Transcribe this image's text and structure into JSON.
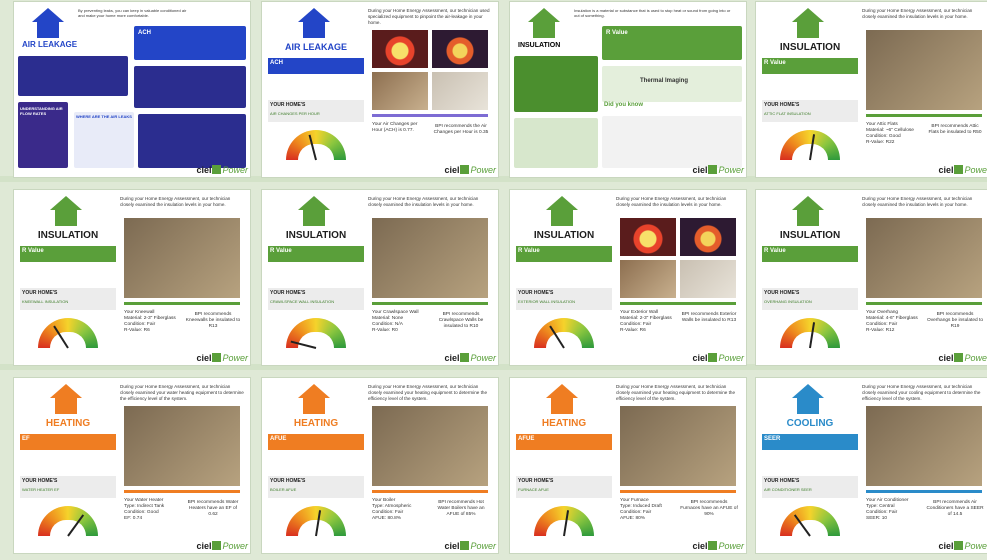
{
  "brand": {
    "logo_text": "ciel",
    "logo_power": "Power"
  },
  "pages": [
    {
      "id": "p1",
      "layout": "infographic",
      "category": "AIR LEAKAGE",
      "theme": "blue",
      "intro": "By preventing leaks, you can keep in valuable conditioned air and make your home more comfortable.",
      "tag": "ACH",
      "sub1": "UNDERSTANDING AIR FLOW RATES",
      "sub2": "WHERE ARE THE AIR LEAKS"
    },
    {
      "id": "p2",
      "layout": "quad",
      "category": "AIR LEAKAGE",
      "theme": "blue",
      "tag": "ACH",
      "intro": "During your Home Energy Assessment, our technician used specialized equipment to pinpoint the air-leakage in your home.",
      "yh_title": "YOUR HOME'S",
      "yh_sub": "AIR CHANGES PER HOUR",
      "stat_left": "Your Air Changes per Hour (ACH) is 0.77.",
      "stat_right": "BPI recommends the Air Changes per Hour is 0.35",
      "needle": 0.42
    },
    {
      "id": "p3",
      "layout": "infographic",
      "category": "INSULATION",
      "theme": "green",
      "intro": "Insulation is a material or substance that is used to stop heat or sound from going into or out of something.",
      "tag": "R Value",
      "sub1": "Thermal Imaging",
      "sub2": "Did you know"
    },
    {
      "id": "p4",
      "layout": "photo",
      "category": "INSULATION",
      "theme": "green",
      "tag": "R Value",
      "intro": "During your Home Energy Assessment, our technician closely examined the insulation levels in your home.",
      "yh_title": "YOUR HOME'S",
      "yh_sub": "ATTIC FLAT INSULATION",
      "stat_left": "Your Attic Flats\nMaterial: ~6\" Cellulose\nCondition: Good\nR-Value: R22",
      "stat_right": "BPI recommends Attic Flats be insulated to R50",
      "needle": 0.55
    },
    {
      "id": "p5",
      "layout": "photo",
      "category": "INSULATION",
      "theme": "green",
      "tag": "R Value",
      "intro": "During your Home Energy Assessment, our technician closely examined the insulation levels in your home.",
      "yh_title": "YOUR HOME'S",
      "yh_sub": "KNEEWALL INSULATION",
      "stat_left": "Your Kneewall\nMaterial: 2-3\" Fiberglass\nCondition: Fair\nR-Value: R6",
      "stat_right": "BPI recommends Kneewalls be insulated to R13",
      "needle": 0.32
    },
    {
      "id": "p6",
      "layout": "photo",
      "category": "INSULATION",
      "theme": "green",
      "tag": "R Value",
      "intro": "During your Home Energy Assessment, our technician closely examined the insulation levels in your home.",
      "yh_title": "YOUR HOME'S",
      "yh_sub": "CRAWLSPACE WALL INSULATION",
      "stat_left": "Your Crawlspace Wall\nMaterial: None\nCondition: N/A\nR-Value: R0",
      "stat_right": "BPI recommends Crawlspace Walls be insulated to R10",
      "needle": 0.08
    },
    {
      "id": "p7",
      "layout": "quad",
      "category": "INSULATION",
      "theme": "green",
      "tag": "R Value",
      "intro": "During your Home Energy Assessment, our technician closely examined the insulation levels in your home.",
      "yh_title": "YOUR HOME'S",
      "yh_sub": "EXTERIOR WALL INSULATION",
      "stat_left": "Your Exterior Wall\nMaterial: 2-3\" Fiberglass\nCondition: Fair\nR-Value: R6",
      "stat_right": "BPI recommends Exterior Walls be insulated to R13",
      "needle": 0.32
    },
    {
      "id": "p8",
      "layout": "photo",
      "category": "INSULATION",
      "theme": "green",
      "tag": "R Value",
      "intro": "During your Home Energy Assessment, our technician closely examined the insulation levels in your home.",
      "yh_title": "YOUR HOME'S",
      "yh_sub": "OVERHANG INSULATION",
      "stat_left": "Your Overhang\nMaterial: 4-6\" Fiberglass\nCondition: Fair\nR-Value: R12",
      "stat_right": "BPI recommends Overhangs be insulated to R19",
      "needle": 0.55
    },
    {
      "id": "p9",
      "layout": "photo",
      "category": "HEATING",
      "theme": "orange",
      "tag": "EF",
      "intro": "During your Home Energy Assessment, our technician closely examined your water heating equipment to determine the efficiency level of the system.",
      "yh_title": "YOUR HOME'S",
      "yh_sub": "WATER HEATER EF",
      "stat_left": "Your Water Heater\nType: Indirect Tank\nCondition: Good\nEF: 0.74",
      "stat_right": "BPI recommends Water Heaters have an EF of 0.62",
      "needle": 0.7
    },
    {
      "id": "p10",
      "layout": "photo",
      "category": "HEATING",
      "theme": "orange",
      "tag": "AFUE",
      "intro": "During your Home Energy Assessment, our technician closely examined your heating equipment to determine the efficiency level of the system.",
      "yh_title": "YOUR HOME'S",
      "yh_sub": "BOILER AFUE",
      "stat_left": "Your Boiler\nType: Atmospheric\nCondition: Fair\nAFUE: 80.8%",
      "stat_right": "BPI recommends Hot Water Boilers have an AFUE of 85%",
      "needle": 0.55
    },
    {
      "id": "p11",
      "layout": "photo",
      "category": "HEATING",
      "theme": "orange",
      "tag": "AFUE",
      "intro": "During your Home Energy Assessment, our technician closely examined your heating equipment to determine the efficiency level of the system.",
      "yh_title": "YOUR HOME'S",
      "yh_sub": "FURNACE AFUE",
      "stat_left": "Your Furnace\nType: Induced Draft\nCondition: Fair\nAFUE: 80%",
      "stat_right": "BPI recommends Furnaces have an AFUE of 90%",
      "needle": 0.55
    },
    {
      "id": "p12",
      "layout": "photo",
      "category": "COOLING",
      "theme": "cyan",
      "tag": "SEER",
      "intro": "During your Home Energy Assessment, our technician closely examined your cooling equipment to determine the efficiency level of the system.",
      "yh_title": "YOUR HOME'S",
      "yh_sub": "AIR CONDITIONER SEER",
      "stat_left": "Your Air Conditioner\nType: Central\nCondition: Fair\nSEER: 10",
      "stat_right": "BPI recommends Air Conditioners have a SEER of 14.5",
      "needle": 0.3
    }
  ]
}
